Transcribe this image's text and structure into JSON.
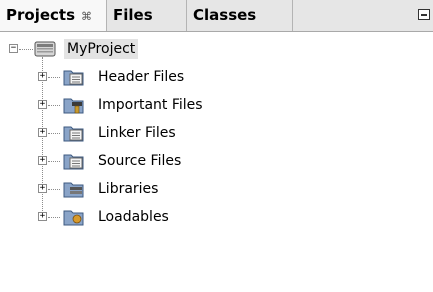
{
  "tabs": [
    {
      "label": "Projects",
      "close": "⌘"
    },
    {
      "label": "Files"
    },
    {
      "label": "Classes"
    }
  ],
  "tree": {
    "root": {
      "label": "MyProject",
      "expander": "−"
    },
    "items": [
      {
        "label": "Header Files",
        "expander": "+"
      },
      {
        "label": "Important Files",
        "expander": "+"
      },
      {
        "label": "Linker Files",
        "expander": "+"
      },
      {
        "label": "Source Files",
        "expander": "+"
      },
      {
        "label": "Libraries",
        "expander": "+"
      },
      {
        "label": "Loadables",
        "expander": "+"
      }
    ]
  },
  "icons": {
    "root": "project-icon",
    "items": [
      "header-folder-icon",
      "important-folder-icon",
      "linker-folder-icon",
      "source-folder-icon",
      "libraries-folder-icon",
      "loadables-folder-icon"
    ]
  }
}
